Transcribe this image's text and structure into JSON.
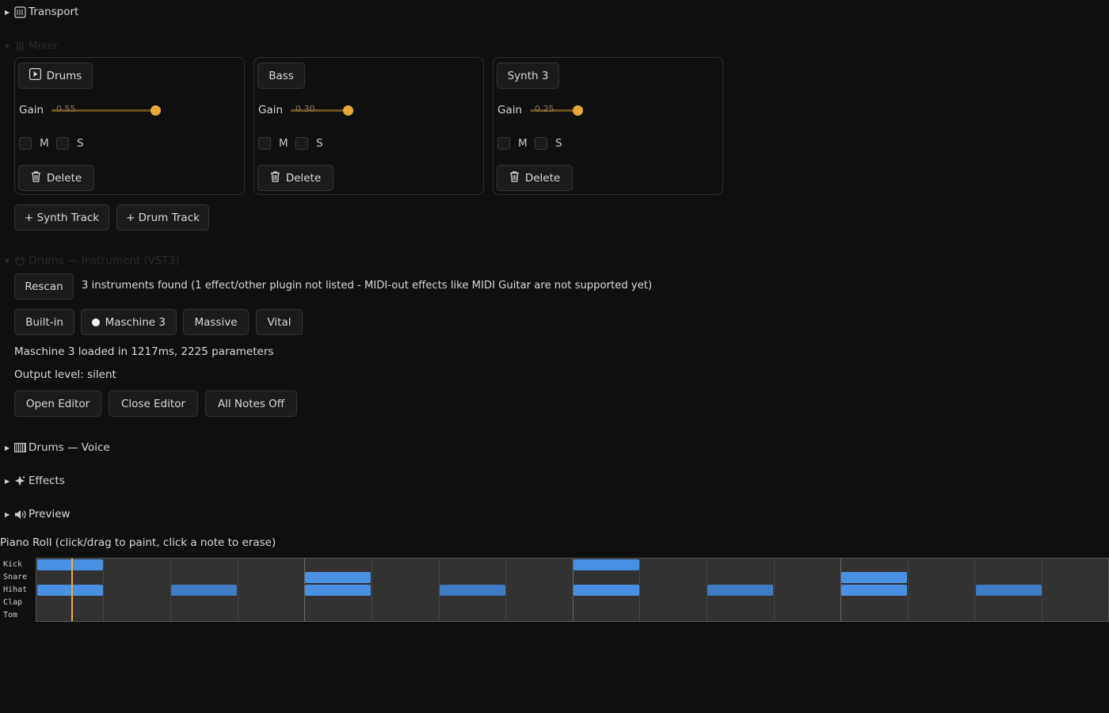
{
  "sections": {
    "transport": "Transport",
    "mixer": "Mixer",
    "instrument": "Drums — Instrument (VST3)",
    "voice": "Drums — Voice",
    "effects": "Effects",
    "preview": "Preview"
  },
  "tracks": [
    {
      "name": "Drums",
      "gain_label": "Gain",
      "gain_value": "0.55",
      "mute_label": "M",
      "solo_label": "S",
      "delete_label": "Delete"
    },
    {
      "name": "Bass",
      "gain_label": "Gain",
      "gain_value": "0.30",
      "mute_label": "M",
      "solo_label": "S",
      "delete_label": "Delete"
    },
    {
      "name": "Synth 3",
      "gain_label": "Gain",
      "gain_value": "0.25",
      "mute_label": "M",
      "solo_label": "S",
      "delete_label": "Delete"
    }
  ],
  "add_buttons": {
    "synth": "+ Synth Track",
    "drum": "+ Drum Track"
  },
  "instrument": {
    "rescan_label": "Rescan",
    "scan_status": "3 instruments found (1 effect/other plugin not listed - MIDI-out effects like MIDI Guitar are not supported yet)",
    "options": [
      "Built-in",
      "Maschine 3",
      "Massive",
      "Vital"
    ],
    "selected": "Maschine 3",
    "load_status": "Maschine 3 loaded in 1217ms, 2225 parameters",
    "output_level": "Output level: silent",
    "open_editor": "Open Editor",
    "close_editor": "Close Editor",
    "all_notes_off": "All Notes Off"
  },
  "piano_roll": {
    "title": "Piano Roll (click/drag to paint, click a note to erase)",
    "rows": [
      "Kick",
      "Snare",
      "Hihat",
      "Clap",
      "Tom"
    ]
  },
  "colors": {
    "accent": "#e8a838",
    "note": "#4a90e2",
    "background": "#0f0f0f"
  }
}
